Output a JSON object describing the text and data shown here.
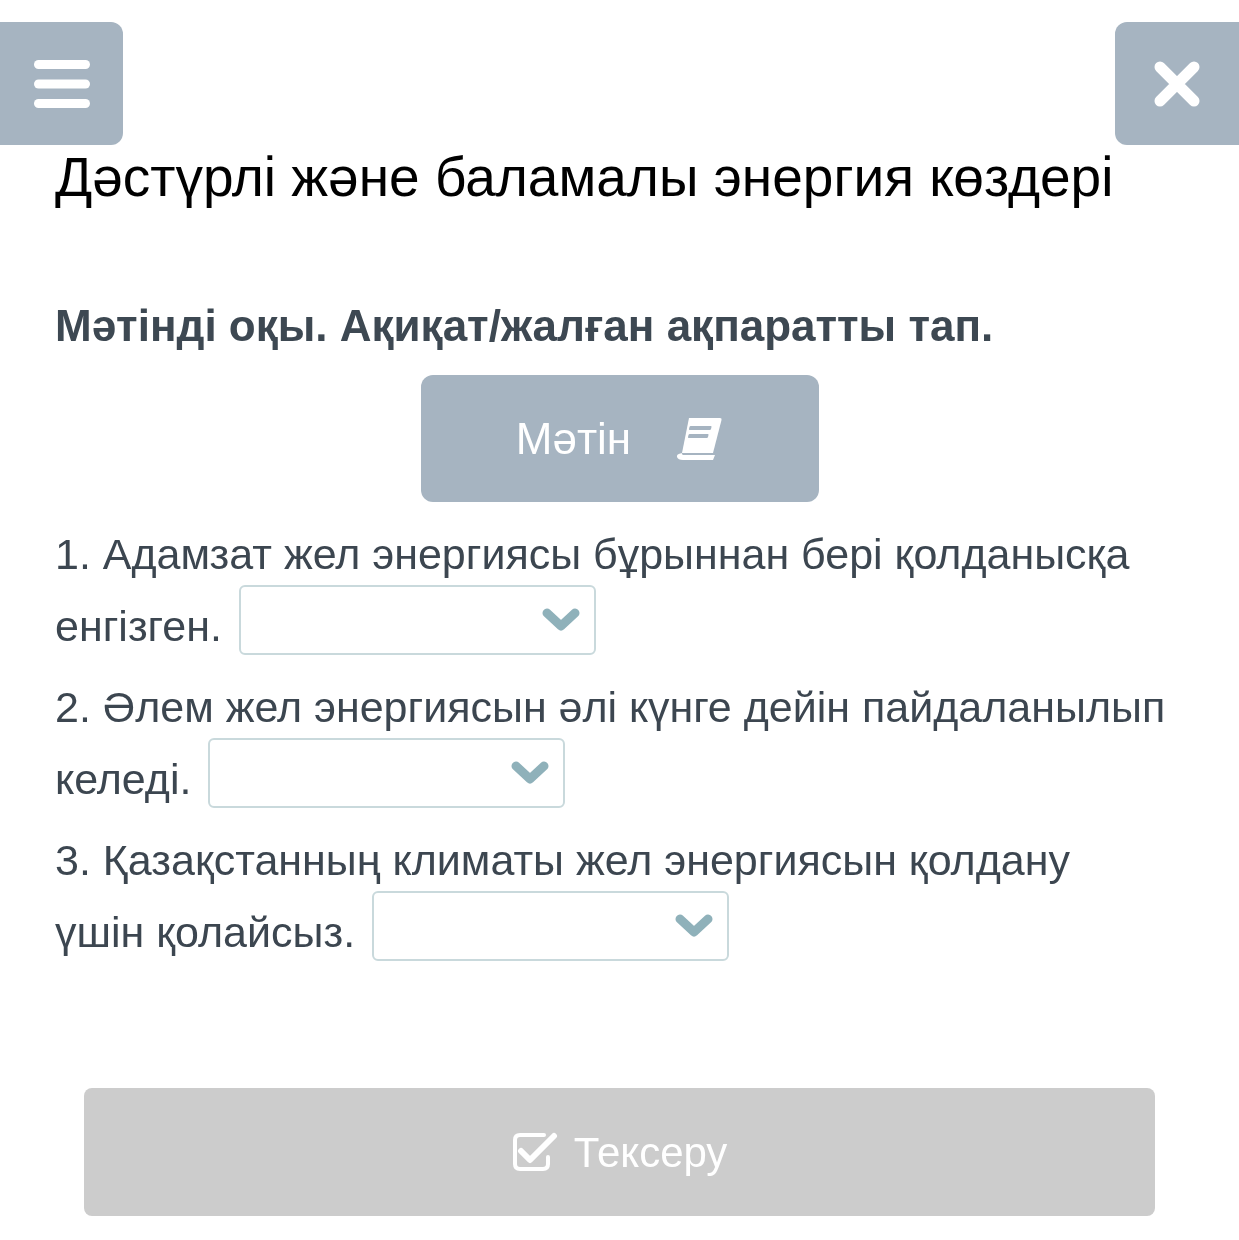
{
  "title": "Дәстүрлі және баламалы энергия көздері",
  "instruction": "Мәтінді оқы. Ақиқат/жалған ақпаратты тап.",
  "text_button": {
    "label": "Мәтін"
  },
  "questions": [
    {
      "lines": [
        "1. Адамзат жел энергиясы бұрыннан бері қолданысқа",
        "енгізген."
      ]
    },
    {
      "lines": [
        "2. Әлем жел энергиясын әлі күнге дейін пайдаланылып",
        "келеді."
      ]
    },
    {
      "lines": [
        "3. Қазақстанның климаты жел энергиясын қолдану",
        "үшін қолайсыз."
      ]
    }
  ],
  "check_button": {
    "label": "Тексеру",
    "disabled": true
  }
}
